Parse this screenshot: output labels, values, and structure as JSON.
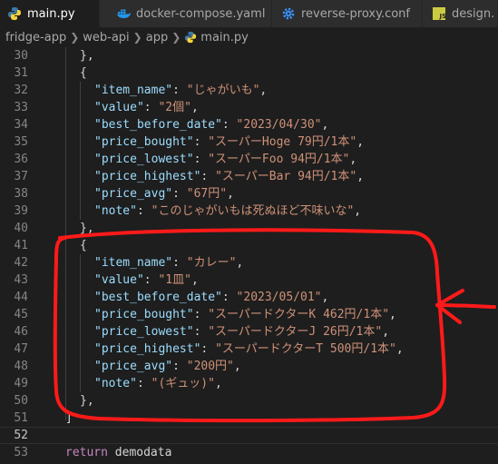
{
  "tabs": [
    {
      "label": "main.py",
      "icon": "python-icon",
      "active": true,
      "modified": true
    },
    {
      "label": "docker-compose.yaml",
      "icon": "docker-icon"
    },
    {
      "label": "reverse-proxy.conf",
      "icon": "gear-icon"
    },
    {
      "label": "design.",
      "icon": "js-icon"
    }
  ],
  "breadcrumb": [
    "fridge-app",
    "web-api",
    "app",
    "main.py"
  ],
  "colors": {
    "annotation": "#ff1a1a"
  },
  "lines": [
    {
      "n": "30",
      "t": "},"
    },
    {
      "n": "31",
      "t": "{"
    },
    {
      "n": "32",
      "k": "\"item_name\"",
      "v": "\"じゃがいも\""
    },
    {
      "n": "33",
      "k": "\"value\"",
      "v": "\"2個\""
    },
    {
      "n": "34",
      "k": "\"best_before_date\"",
      "v": "\"2023/04/30\""
    },
    {
      "n": "35",
      "k": "\"price_bought\"",
      "v": "\"スーパーHoge 79円/1本\""
    },
    {
      "n": "36",
      "k": "\"price_lowest\"",
      "v": "\"スーパーFoo 94円/1本\""
    },
    {
      "n": "37",
      "k": "\"price_highest\"",
      "v": "\"スーパーBar 94円/1本\""
    },
    {
      "n": "38",
      "k": "\"price_avg\"",
      "v": "\"67円\""
    },
    {
      "n": "39",
      "k": "\"note\"",
      "v": "\"このじゃがいもは死ぬほど不味いな\""
    },
    {
      "n": "40",
      "t": "},"
    },
    {
      "n": "41",
      "t": "{"
    },
    {
      "n": "42",
      "k": "\"item_name\"",
      "v": "\"カレー\""
    },
    {
      "n": "43",
      "k": "\"value\"",
      "v": "\"1皿\""
    },
    {
      "n": "44",
      "k": "\"best_before_date\"",
      "v": "\"2023/05/01\""
    },
    {
      "n": "45",
      "k": "\"price_bought\"",
      "v": "\"スーパードクターK 462円/1本\""
    },
    {
      "n": "46",
      "k": "\"price_lowest\"",
      "v": "\"スーパードクターJ 26円/1本\""
    },
    {
      "n": "47",
      "k": "\"price_highest\"",
      "v": "\"スーパードクターT 500円/1本\""
    },
    {
      "n": "48",
      "k": "\"price_avg\"",
      "v": "\"200円\""
    },
    {
      "n": "49",
      "k": "\"note\"",
      "v": "\"(ギュッ)\""
    },
    {
      "n": "50",
      "t": "},"
    },
    {
      "n": "51",
      "t": "]"
    },
    {
      "n": "52",
      "t": ""
    },
    {
      "n": "53",
      "kw": "return",
      "rest": " demodata"
    }
  ]
}
